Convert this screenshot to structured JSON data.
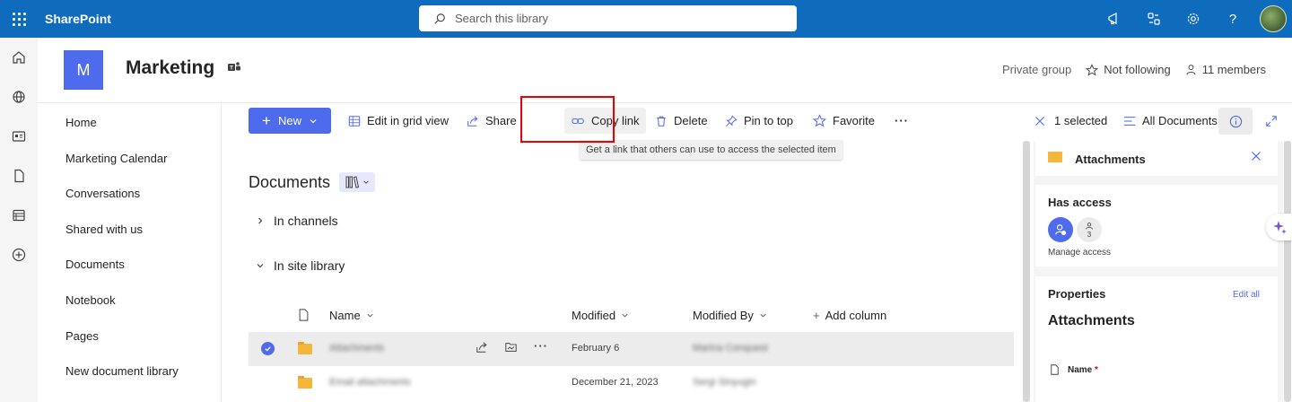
{
  "suitebar": {
    "brand": "SharePoint",
    "search_placeholder": "Search this library",
    "icons": [
      "megaphone-icon",
      "share-feed-icon",
      "settings-icon",
      "help-icon"
    ]
  },
  "site": {
    "logo_letter": "M",
    "title": "Marketing",
    "privacy": "Private group",
    "follow": "Not following",
    "members": "11 members"
  },
  "nav": {
    "items": [
      "Home",
      "Marketing Calendar",
      "Conversations",
      "Shared with us",
      "Documents",
      "Notebook",
      "Pages",
      "New document library"
    ]
  },
  "commands": {
    "new": "New",
    "edit_grid": "Edit in grid view",
    "share": "Share",
    "copy_link": "Copy link",
    "delete": "Delete",
    "pin": "Pin to top",
    "favorite": "Favorite",
    "more": "···",
    "selected": "1 selected",
    "view": "All Documents",
    "tooltip": "Get a link that others can use to access the selected item"
  },
  "library": {
    "title": "Documents",
    "sections": [
      "In channels",
      "In site library"
    ],
    "columns": {
      "name": "Name",
      "modified": "Modified",
      "modified_by": "Modified By",
      "add_column": "Add column"
    },
    "rows": [
      {
        "name": "Attachments",
        "modified": "February 6",
        "modified_by": "Marina Conquest",
        "selected": true
      },
      {
        "name": "Email attachments",
        "modified": "December 21, 2023",
        "modified_by": "Sergi Sinyugin",
        "selected": false
      }
    ]
  },
  "details": {
    "title": "Attachments",
    "has_access": "Has access",
    "access_count": "3",
    "manage_access": "Manage access",
    "properties": "Properties",
    "edit_all": "Edit all",
    "prop_title": "Attachments",
    "name_label": "Name",
    "required_mark": "*"
  },
  "colors": {
    "suitebar": "#0f6cbd",
    "accent": "#4f6bed",
    "folder": "#f4b73b",
    "highlight": "#ee0000"
  }
}
